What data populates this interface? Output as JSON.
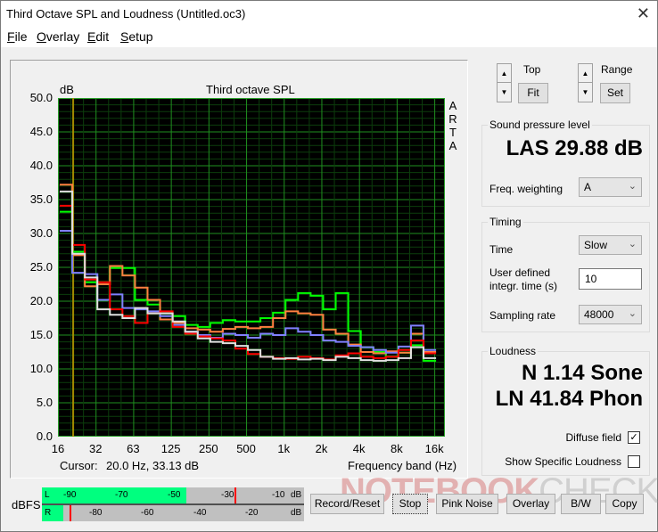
{
  "window": {
    "title": "Third Octave SPL and Loudness (Untitled.oc3)",
    "close_icon": "close-icon"
  },
  "menu": [
    {
      "label": "File",
      "underline": "F",
      "rest": "ile"
    },
    {
      "label": "Overlay",
      "underline": "O",
      "rest": "verlay"
    },
    {
      "label": "Edit",
      "underline": "E",
      "rest": "dit"
    },
    {
      "label": "Setup",
      "underline": "S",
      "rest": "etup"
    }
  ],
  "plot": {
    "ylabel_unit": "dB",
    "title": "Third octave SPL",
    "brand_vertical": [
      "A",
      "R",
      "T",
      "A"
    ],
    "cursor_label": "Cursor:",
    "cursor_value": "20.0 Hz, 33.13 dB",
    "xlabel": "Frequency band (Hz)"
  },
  "chart_data": {
    "type": "line",
    "title": "Third octave SPL",
    "xlabel": "Frequency band (Hz)",
    "ylabel": "dB",
    "ylim": [
      0,
      50
    ],
    "yticks": [
      "50.0",
      "45.0",
      "40.0",
      "35.0",
      "30.0",
      "25.0",
      "20.0",
      "15.0",
      "10.0",
      "5.0",
      "0.0"
    ],
    "xticks": [
      "16",
      "32",
      "63",
      "125",
      "250",
      "500",
      "1k",
      "2k",
      "4k",
      "8k",
      "16k"
    ],
    "grid": true,
    "background": "#000000",
    "grid_color": "#1a7a1a",
    "cursor_hz": 20.0,
    "cursor_color": "#a08a00",
    "x_bands": [
      "16",
      "20",
      "25",
      "31.5",
      "40",
      "50",
      "63",
      "80",
      "100",
      "125",
      "160",
      "200",
      "250",
      "315",
      "400",
      "500",
      "630",
      "800",
      "1k",
      "1.25k",
      "1.6k",
      "2k",
      "2.5k",
      "3.15k",
      "4k",
      "5k",
      "6.3k",
      "8k",
      "10k",
      "12.5k",
      "16k"
    ],
    "series": [
      {
        "name": "green",
        "color": "#00ff00",
        "values": [
          33.2,
          27.3,
          22.8,
          22.5,
          24.9,
          24.9,
          20.2,
          19.5,
          18.2,
          17.8,
          16.5,
          16.2,
          16.8,
          17.2,
          17.0,
          17.0,
          17.5,
          18.3,
          20.2,
          21.2,
          20.8,
          18.8,
          21.2,
          15.6,
          13.2,
          12.5,
          11.8,
          12.4,
          13.5,
          11.2
        ]
      },
      {
        "name": "orange",
        "color": "#ff8040",
        "values": [
          37.2,
          26.8,
          22.2,
          22.5,
          25.2,
          23.8,
          22.0,
          20.2,
          17.3,
          16.8,
          16.0,
          15.8,
          15.5,
          15.9,
          16.2,
          16.0,
          16.2,
          17.5,
          18.5,
          18.2,
          18.0,
          15.8,
          15.2,
          13.6,
          12.5,
          12.3,
          12.6,
          12.4,
          15.2,
          12.5
        ]
      },
      {
        "name": "blue",
        "color": "#8080ff",
        "values": [
          30.4,
          24.2,
          24.0,
          20.2,
          21.0,
          19.0,
          18.8,
          18.5,
          17.8,
          16.5,
          15.5,
          15.0,
          14.6,
          15.2,
          15.0,
          14.6,
          15.2,
          15.0,
          16.0,
          15.5,
          15.0,
          14.2,
          14.0,
          13.4,
          13.2,
          12.8,
          12.4,
          13.3,
          16.4,
          12.8
        ]
      },
      {
        "name": "red",
        "color": "#ff0000",
        "values": [
          34.1,
          28.3,
          23.2,
          22.8,
          18.8,
          17.8,
          16.8,
          18.2,
          18.5,
          16.2,
          15.2,
          14.8,
          14.5,
          14.2,
          13.0,
          12.2,
          11.8,
          11.6,
          11.5,
          11.8,
          11.6,
          11.4,
          12.0,
          12.3,
          11.8,
          11.6,
          11.8,
          12.8,
          14.2,
          12.3
        ]
      },
      {
        "name": "white",
        "color": "#e0e0e0",
        "values": [
          36.2,
          27.0,
          23.5,
          18.8,
          18.0,
          17.5,
          19.0,
          18.2,
          18.2,
          17.0,
          15.5,
          14.5,
          14.0,
          13.8,
          13.4,
          12.8,
          11.8,
          11.5,
          11.6,
          11.4,
          11.5,
          11.3,
          11.8,
          11.6,
          11.3,
          11.2,
          11.3,
          11.6,
          13.2,
          11.6
        ]
      }
    ]
  },
  "controls": {
    "top_label": "Top",
    "fit_label": "Fit",
    "range_label": "Range",
    "set_label": "Set"
  },
  "spl": {
    "group_title": "Sound pressure level",
    "value": "LAS 29.88 dB",
    "weighting_label": "Freq. weighting",
    "weighting_value": "A"
  },
  "timing": {
    "group_title": "Timing",
    "time_label": "Time",
    "time_value": "Slow",
    "integr_label_1": "User defined",
    "integr_label_2": "integr. time (s)",
    "integr_value": "10",
    "sampling_label": "Sampling rate",
    "sampling_value": "48000"
  },
  "loudness": {
    "group_title": "Loudness",
    "n_value": "N 1.14 Sone",
    "ln_value": "LN 41.84 Phon",
    "diffuse_label": "Diffuse field",
    "diffuse_checked": true,
    "specific_label": "Show Specific Loudness",
    "specific_checked": false
  },
  "meter": {
    "label": "dBFS",
    "left_channel": "L",
    "right_channel": "R",
    "left_ticks": [
      "-90",
      "-70",
      "-50",
      "-30",
      "-10",
      "dB"
    ],
    "right_ticks": [
      "-80",
      "-60",
      "-40",
      "-20",
      "dB"
    ],
    "left_level_fraction": 0.55,
    "left_peak_fraction": 0.735,
    "right_level_fraction": 0.08,
    "right_peak_fraction": 0.105
  },
  "buttons": {
    "record": "Record/Reset",
    "stop": "Stop",
    "pink": "Pink Noise",
    "overlay": "Overlay",
    "bw": "B/W",
    "copy": "Copy"
  },
  "watermark": {
    "a": "NOTEBOOK",
    "b": "CHECK"
  }
}
